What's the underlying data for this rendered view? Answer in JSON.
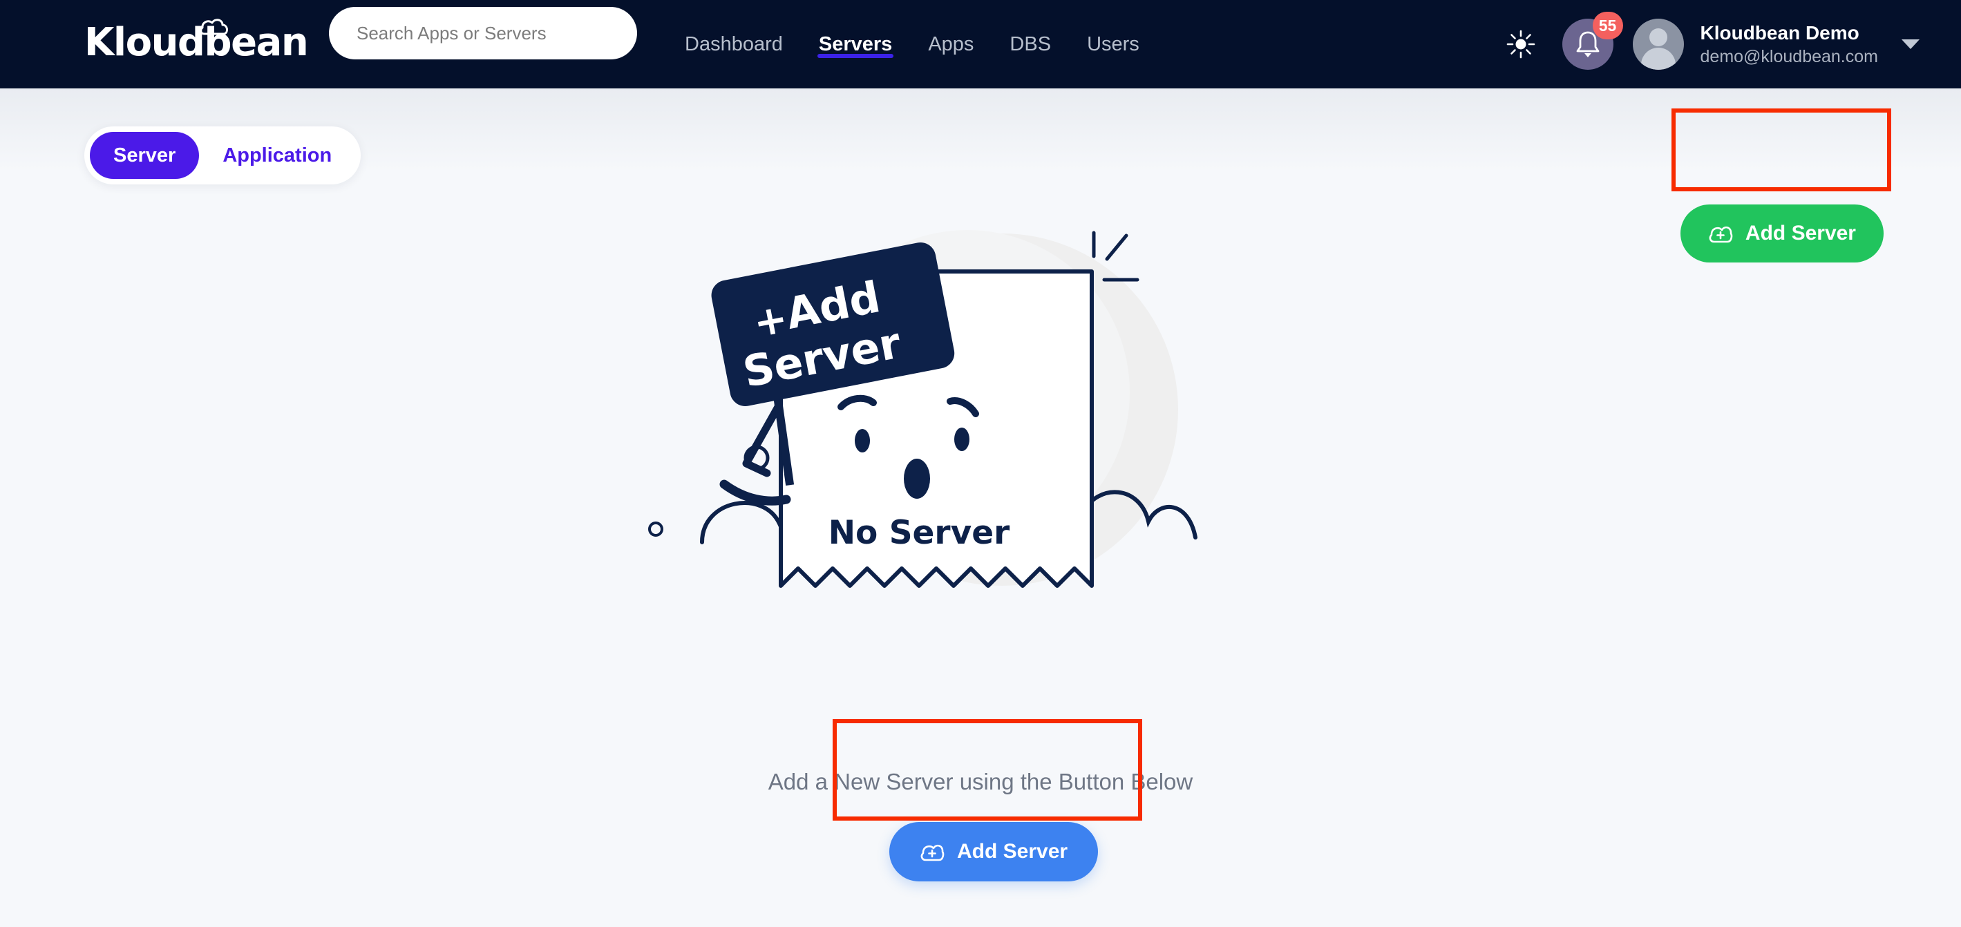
{
  "brand": {
    "name": "Kloudbean",
    "logo_icon": "cloud-icon",
    "logo_part_1": "Kloud",
    "logo_part_2": "bean"
  },
  "header": {
    "search": {
      "placeholder": "Search Apps or Servers",
      "value": "",
      "icon": "search-input"
    },
    "nav": [
      {
        "label": "Dashboard",
        "active": false
      },
      {
        "label": "Servers",
        "active": true
      },
      {
        "label": "Apps",
        "active": false
      },
      {
        "label": "DBS",
        "active": false
      },
      {
        "label": "Users",
        "active": false
      }
    ],
    "theme_toggle_icon": "sun-icon",
    "notifications": {
      "icon": "bell-icon",
      "count": "55"
    },
    "account": {
      "avatar_icon": "user-avatar-icon",
      "name": "Kloudbean Demo",
      "email": "demo@kloudbean.com",
      "caret_icon": "chevron-down-icon"
    }
  },
  "main": {
    "tabs": [
      {
        "label": "Server",
        "active": true
      },
      {
        "label": "Application",
        "active": false
      }
    ],
    "primary_action": {
      "label": "Add Server",
      "icon": "cloud-plus-icon",
      "color": "#21c45d"
    },
    "secondary_action": {
      "label": "Add Server",
      "icon": "cloud-plus-icon",
      "color": "#3d82f0"
    },
    "empty_state": {
      "sign_plus": "+",
      "sign_line_1": "Add",
      "sign_line_2": "Server",
      "receipt_label": "No Server",
      "hint": "Add a New Server using the Button Below"
    }
  },
  "annotations": [
    {
      "target": "top-add-server-button",
      "color": "#f72b00"
    },
    {
      "target": "bottom-add-server-button",
      "color": "#f72b00"
    }
  ],
  "colors": {
    "header_bg": "#04102b",
    "page_bg": "#f6f8fb",
    "accent_purple": "#4b1ae8",
    "accent_green": "#21c45d",
    "accent_blue": "#3d82f0",
    "badge_red": "#f4605e",
    "annotation_red": "#f72b00",
    "illustration_navy": "#0d2149"
  }
}
